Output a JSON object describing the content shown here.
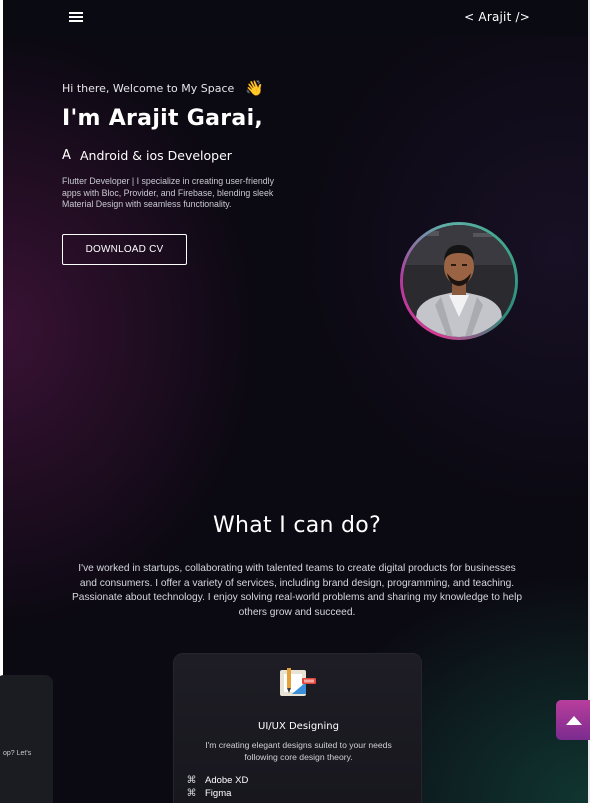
{
  "header": {
    "menu_icon": "hamburger-menu-icon",
    "logo": "< Arajit />"
  },
  "hero": {
    "greeting": "Hi there, Welcome to My Space",
    "greeting_icon": "waving-hand-icon",
    "greeting_emoji": "👋",
    "name": "I'm Arajit Garai,",
    "role_prefix": "A",
    "role": "Android & ios Developer",
    "bio": "Flutter Developer | I specialize in creating user-friendly apps with Bloc, Provider, and Firebase, blending sleek Material Design with seamless functionality.",
    "cta_label": "DOWNLOAD CV",
    "avatar_icon": "profile-photo",
    "ring_colors": [
      "#d63c92",
      "#3fa58a"
    ]
  },
  "services": {
    "title": "What I can do?",
    "description": "I've worked in startups, collaborating with talented teams to create digital products for businesses and consumers. I offer a variety of services, including brand design, programming, and teaching. Passionate about technology. I enjoy solving real-world problems and sharing my knowledge to help others grow and succeed.",
    "side_card_text": "op? Let's",
    "card": {
      "icon": "design-tools-icon",
      "title": "UI/UX Designing",
      "description": "I'm creating elegant designs suited to your needs following core design theory.",
      "tools": [
        {
          "icon": "adobe-xd-icon",
          "label": "Adobe XD"
        },
        {
          "icon": "figma-icon",
          "label": "Figma"
        }
      ]
    }
  },
  "scroll_top": {
    "icon": "arrow-up-icon",
    "color": "#b83e9c"
  },
  "colors": {
    "background": "#0b0912",
    "accent_pink": "#d63c92",
    "accent_teal": "#3fa58a"
  }
}
